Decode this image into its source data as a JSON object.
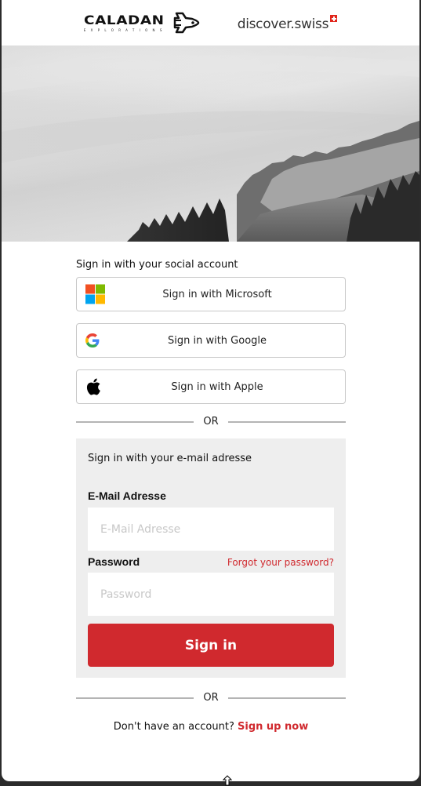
{
  "header": {
    "brand_left": {
      "name": "CALADAN",
      "subtitle": "EXPLORATIONS",
      "icon": "space-shuttle-icon"
    },
    "brand_right": {
      "name": "discover.swiss",
      "icon": "swiss-flag-icon"
    }
  },
  "hero": {
    "description": "black-and-white fog over forested hill"
  },
  "social": {
    "title": "Sign in with your social account",
    "buttons": [
      {
        "label": "Sign in with Microsoft",
        "icon": "microsoft-icon"
      },
      {
        "label": "Sign in with Google",
        "icon": "google-icon"
      },
      {
        "label": "Sign in with Apple",
        "icon": "apple-icon"
      }
    ]
  },
  "divider": {
    "text": "OR"
  },
  "email_form": {
    "title": "Sign in with your e-mail adresse",
    "email_label": "E-Mail Adresse",
    "email_placeholder": "E-Mail Adresse",
    "email_value": "",
    "password_label": "Password",
    "password_placeholder": "Password",
    "password_value": "",
    "forgot_link": "Forgot your password?",
    "submit_label": "Sign in"
  },
  "signup": {
    "prompt": "Don't have an account?",
    "link": "Sign up now"
  },
  "colors": {
    "accent": "#d0292e",
    "panel_bg": "#eeeeee",
    "border": "#c8c8c8"
  }
}
